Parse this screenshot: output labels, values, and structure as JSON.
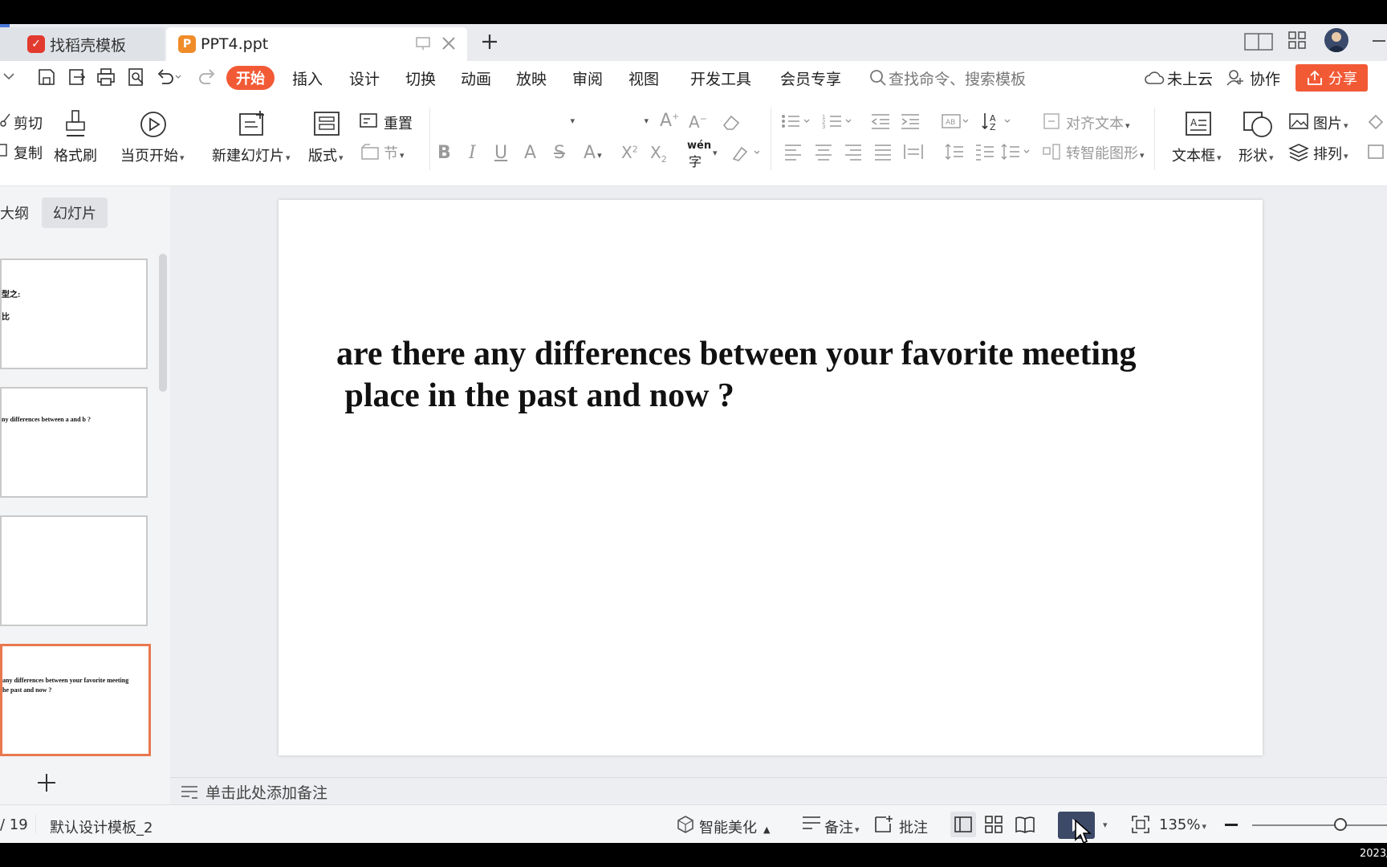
{
  "tabs": [
    {
      "label": "找稻壳模板",
      "icon": "docer-icon"
    },
    {
      "label": "PPT4.ppt",
      "icon": "ppt-file-icon"
    }
  ],
  "menu": [
    "开始",
    "插入",
    "设计",
    "切换",
    "动画",
    "放映",
    "审阅",
    "视图",
    "开发工具",
    "会员专享"
  ],
  "search_placeholder": "查找命令、搜索模板",
  "top_right": {
    "cloud": "未上云",
    "collab": "协作",
    "share": "分享"
  },
  "ribbon": {
    "cut": "剪切",
    "copy": "复制",
    "format_painter": "格式刷",
    "from_current": "当页开始",
    "new_slide": "新建幻灯片",
    "layout": "版式",
    "reset": "重置",
    "section": "节",
    "align_text": "对齐文本",
    "smart_art": "转智能图形",
    "textbox": "文本框",
    "shape": "形状",
    "picture": "图片",
    "arrange": "排列",
    "wen": "wén"
  },
  "panel_tabs": {
    "outline": "大纲",
    "slides": "幻灯片"
  },
  "thumbnails": [
    {
      "lines": [
        "型之:",
        "比"
      ]
    },
    {
      "lines": [
        "ny differences between a and b ?"
      ]
    },
    {
      "lines": []
    },
    {
      "lines": [
        "any differences between your favorite meeting",
        "he past and now ?"
      ]
    }
  ],
  "slide": {
    "line1": "are there any differences between your favorite meeting",
    "line2": " place in the past and now ?"
  },
  "notes_placeholder": "单击此处添加备注",
  "status": {
    "page": "/ 19",
    "template": "默认设计模板_2",
    "beautify": "智能美化",
    "notes": "备注",
    "comments": "批注",
    "zoom": "135%"
  },
  "clock": "2023/",
  "colors": {
    "accent": "#f25a36",
    "selected_border": "#e9784f",
    "tab_blue": "#4a77d8"
  }
}
